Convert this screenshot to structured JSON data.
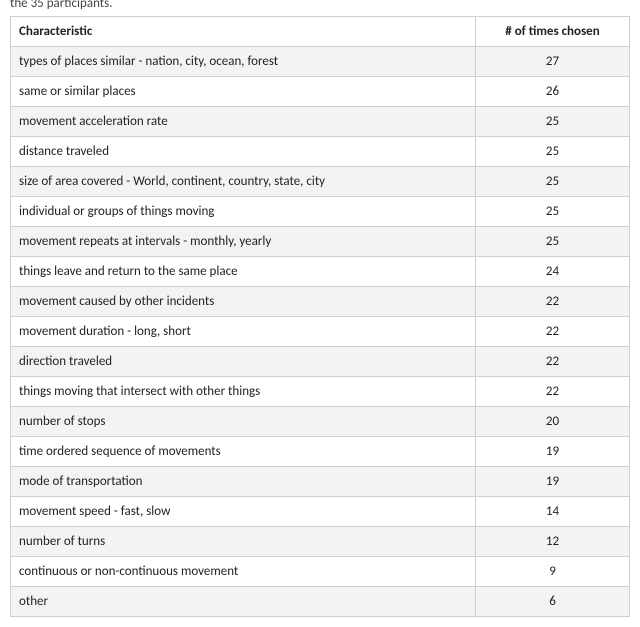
{
  "fragment_text": "the 35 participants.",
  "table": {
    "headers": {
      "characteristic": "Characteristic",
      "count": "# of times chosen"
    },
    "rows": [
      {
        "characteristic": "types of places similar - nation, city, ocean, forest",
        "count": "27"
      },
      {
        "characteristic": "same or similar places",
        "count": "26"
      },
      {
        "characteristic": "movement acceleration rate",
        "count": "25"
      },
      {
        "characteristic": "distance traveled",
        "count": "25"
      },
      {
        "characteristic": "size of area covered - World, continent, country, state, city",
        "count": "25"
      },
      {
        "characteristic": "individual or groups of things moving",
        "count": "25"
      },
      {
        "characteristic": "movement repeats at intervals - monthly, yearly",
        "count": "25"
      },
      {
        "characteristic": "things leave and return to the same place",
        "count": "24"
      },
      {
        "characteristic": "movement caused by other incidents",
        "count": "22"
      },
      {
        "characteristic": "movement duration - long, short",
        "count": "22"
      },
      {
        "characteristic": "direction traveled",
        "count": "22"
      },
      {
        "characteristic": "things moving that intersect with other things",
        "count": "22"
      },
      {
        "characteristic": "number of stops",
        "count": "20"
      },
      {
        "characteristic": "time ordered sequence of movements",
        "count": "19"
      },
      {
        "characteristic": "mode of transportation",
        "count": "19"
      },
      {
        "characteristic": "movement speed - fast, slow",
        "count": "14"
      },
      {
        "characteristic": "number of turns",
        "count": "12"
      },
      {
        "characteristic": "continuous or non-continuous movement",
        "count": "9"
      },
      {
        "characteristic": "other",
        "count": "6"
      }
    ]
  }
}
